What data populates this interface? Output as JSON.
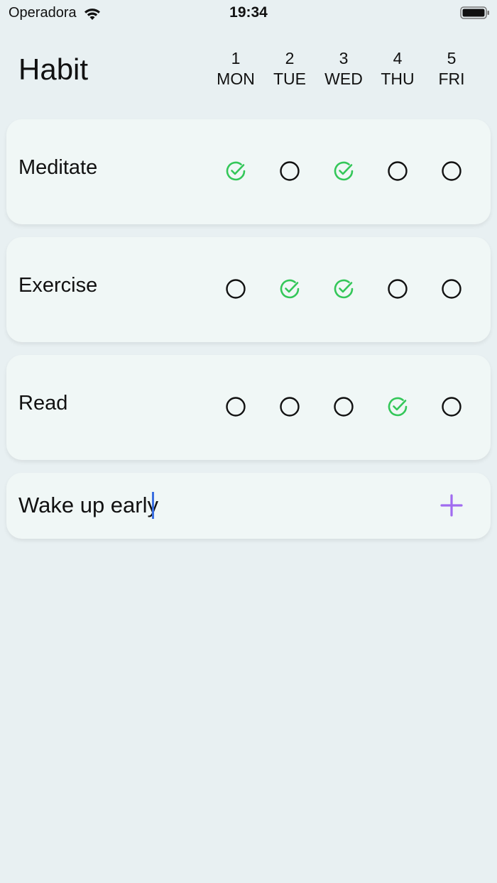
{
  "status_bar": {
    "carrier": "Operadora",
    "time": "19:34"
  },
  "header": {
    "title": "Habit",
    "days": [
      {
        "number": "1",
        "label": "MON"
      },
      {
        "number": "2",
        "label": "TUE"
      },
      {
        "number": "3",
        "label": "WED"
      },
      {
        "number": "4",
        "label": "THU"
      },
      {
        "number": "5",
        "label": "FRI"
      }
    ]
  },
  "habits": [
    {
      "name": "Meditate",
      "done": [
        true,
        false,
        true,
        false,
        false
      ]
    },
    {
      "name": "Exercise",
      "done": [
        false,
        true,
        true,
        false,
        false
      ]
    },
    {
      "name": "Read",
      "done": [
        false,
        false,
        false,
        true,
        false
      ]
    }
  ],
  "new_habit": {
    "value": "Wake up early",
    "placeholder": ""
  },
  "colors": {
    "done": "#34c759",
    "add": "#a06bf0",
    "caret": "#3b6fe0"
  },
  "icons": {
    "done": "check-circle-icon",
    "not_done": "empty-circle-icon",
    "add": "plus-icon"
  }
}
